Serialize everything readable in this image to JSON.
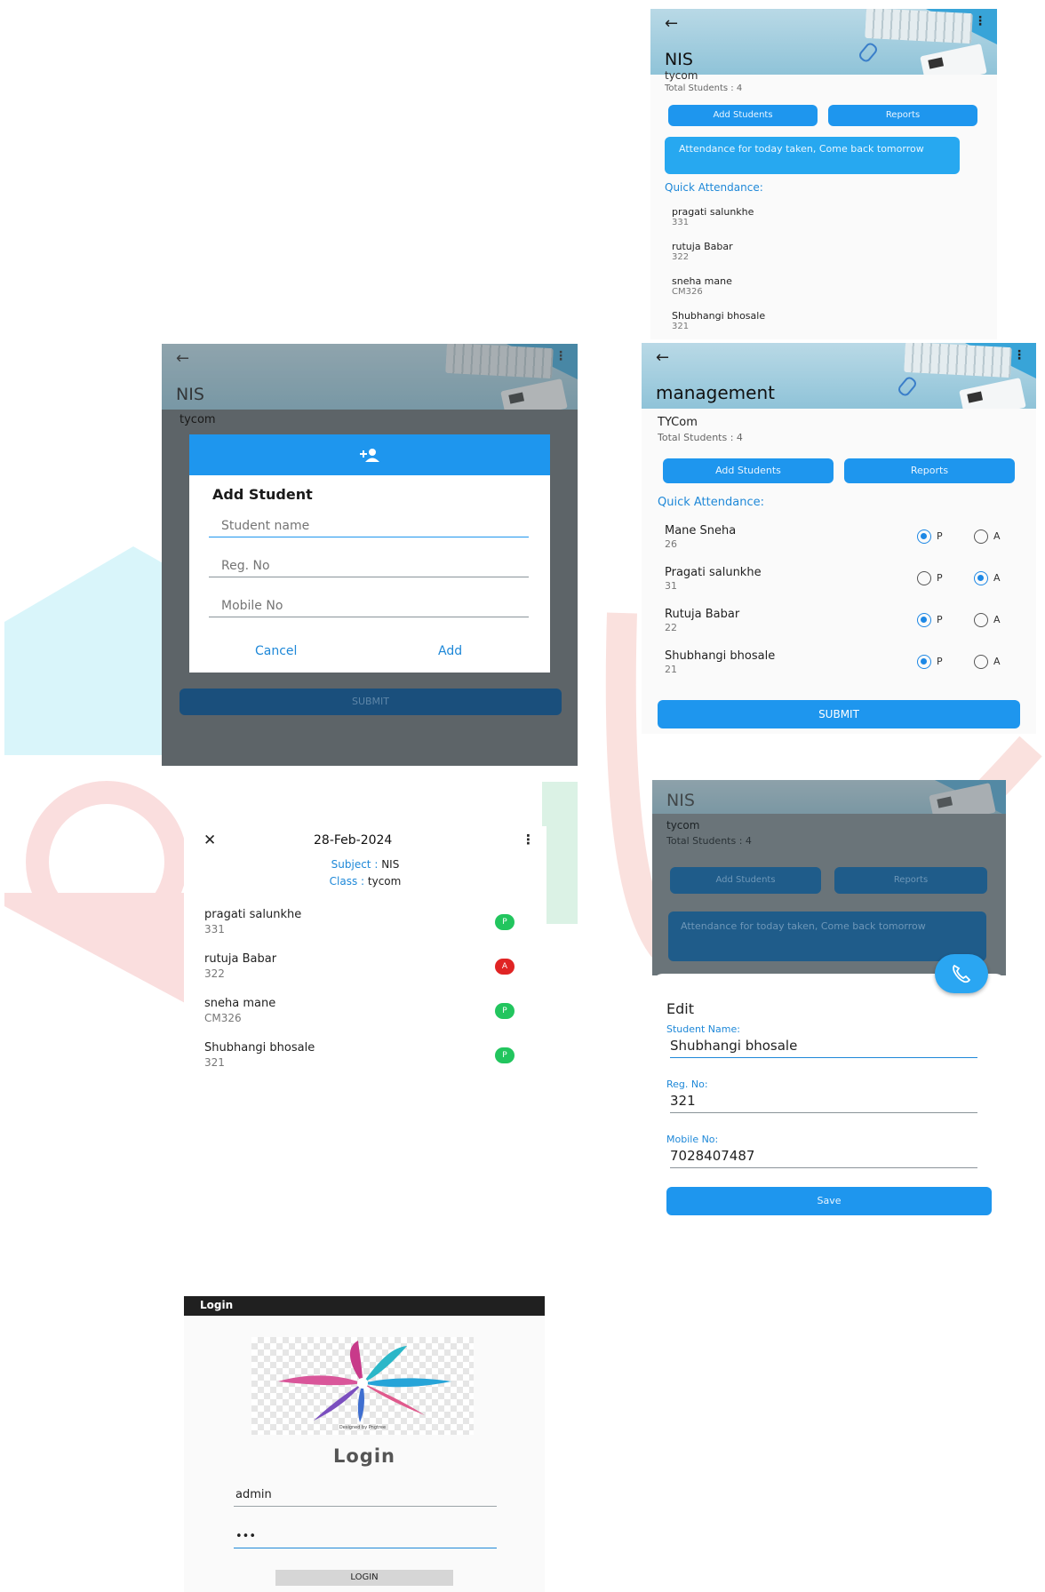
{
  "screen_nis_top": {
    "title": "NIS",
    "class_name": "tycom",
    "total_students": "Total Students : 4",
    "add_students": "Add Students",
    "reports": "Reports",
    "notice": "Attendance for today taken, Come back tomorrow",
    "quick_attendance": "Quick Attendance:",
    "students": [
      {
        "name": "pragati salunkhe",
        "reg": "331"
      },
      {
        "name": "rutuja Babar",
        "reg": "322"
      },
      {
        "name": "sneha mane",
        "reg": "CM326"
      },
      {
        "name": "Shubhangi bhosale",
        "reg": "321"
      }
    ]
  },
  "screen_add_student": {
    "title": "NIS",
    "class_name": "tycom",
    "dialog_title": "Add Student",
    "name_placeholder": "Student name",
    "reg_placeholder": "Reg. No",
    "mobile_placeholder": "Mobile No",
    "cancel": "Cancel",
    "add": "Add",
    "submit": "SUBMIT"
  },
  "screen_management": {
    "title": "management",
    "class_name": "TYCom",
    "total_students": "Total Students : 4",
    "add_students": "Add Students",
    "reports": "Reports",
    "quick_attendance": "Quick Attendance:",
    "present_label": "P",
    "absent_label": "A",
    "students": [
      {
        "name": "Mane Sneha",
        "reg": "26",
        "status": "P"
      },
      {
        "name": "Pragati salunkhe",
        "reg": "31",
        "status": "A"
      },
      {
        "name": "Rutuja Babar",
        "reg": "22",
        "status": "P"
      },
      {
        "name": "Shubhangi bhosale",
        "reg": "21",
        "status": "P"
      }
    ],
    "submit": "SUBMIT"
  },
  "screen_report": {
    "date": "28-Feb-2024",
    "subject_label": "Subject :",
    "subject": "NIS",
    "class_label": "Class :",
    "class_name": "tycom",
    "students": [
      {
        "name": "pragati salunkhe",
        "reg": "331",
        "status": "P"
      },
      {
        "name": "rutuja Babar",
        "reg": "322",
        "status": "A"
      },
      {
        "name": "sneha mane",
        "reg": "CM326",
        "status": "P"
      },
      {
        "name": "Shubhangi bhosale",
        "reg": "321",
        "status": "P"
      }
    ],
    "colors": {
      "present": "#22c55e",
      "absent": "#e02424"
    }
  },
  "screen_edit": {
    "title": "NIS",
    "class_name": "tycom",
    "total_students": "Total Students : 4",
    "add_students": "Add Students",
    "reports": "Reports",
    "notice": "Attendance for today taken, Come back tomorrow",
    "sheet_title": "Edit",
    "name_label": "Student Name:",
    "name_value": "Shubhangi bhosale",
    "reg_label": "Reg. No:",
    "reg_value": "321",
    "mobile_label": "Mobile No:",
    "mobile_value": "7028407487",
    "save": "Save"
  },
  "screen_login": {
    "bar_title": "Login",
    "logo_caption": "Designed by Pngtree",
    "heading": "Login",
    "username_value": "admin",
    "password_value": "•••",
    "login_button": "LOGIN"
  },
  "colors": {
    "accent": "#1e96ee",
    "header_gradient": "#9ccbdd",
    "login_bar": "#202020"
  }
}
